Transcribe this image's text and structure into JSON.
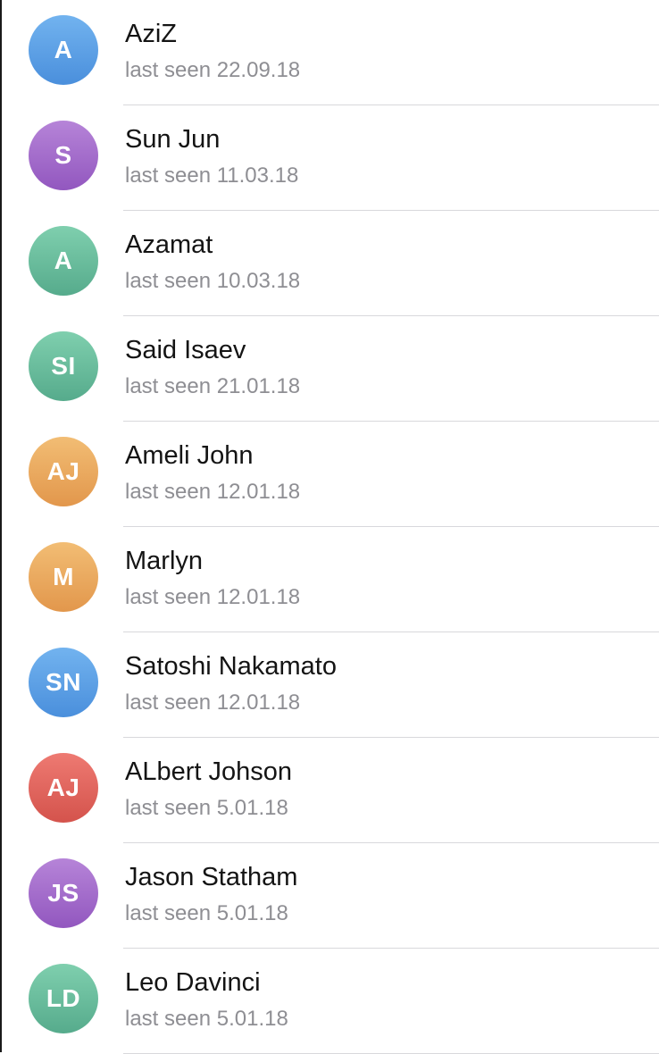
{
  "contacts": [
    {
      "initials": "A",
      "name": "AziZ",
      "status": "last seen 22.09.18",
      "color": "blue"
    },
    {
      "initials": "S",
      "name": "Sun Jun",
      "status": "last seen 11.03.18",
      "color": "purple"
    },
    {
      "initials": "A",
      "name": "Azamat",
      "status": "last seen 10.03.18",
      "color": "green"
    },
    {
      "initials": "SI",
      "name": "Said Isaev",
      "status": "last seen 21.01.18",
      "color": "green"
    },
    {
      "initials": "AJ",
      "name": "Ameli John",
      "status": "last seen 12.01.18",
      "color": "orange"
    },
    {
      "initials": "M",
      "name": "Marlyn",
      "status": "last seen 12.01.18",
      "color": "orange"
    },
    {
      "initials": "SN",
      "name": "Satoshi Nakamato",
      "status": "last seen 12.01.18",
      "color": "blue"
    },
    {
      "initials": "AJ",
      "name": "ALbert Johson",
      "status": "last seen 5.01.18",
      "color": "red"
    },
    {
      "initials": "JS",
      "name": "Jason Statham",
      "status": "last seen 5.01.18",
      "color": "purple"
    },
    {
      "initials": "LD",
      "name": "Leo Davinci",
      "status": "last seen 5.01.18",
      "color": "green"
    }
  ],
  "avatar_colors": {
    "blue": "#5d9fe6",
    "purple": "#a46dcc",
    "green": "#6bbd9d",
    "orange": "#ebaa5f",
    "red": "#e0665f"
  }
}
